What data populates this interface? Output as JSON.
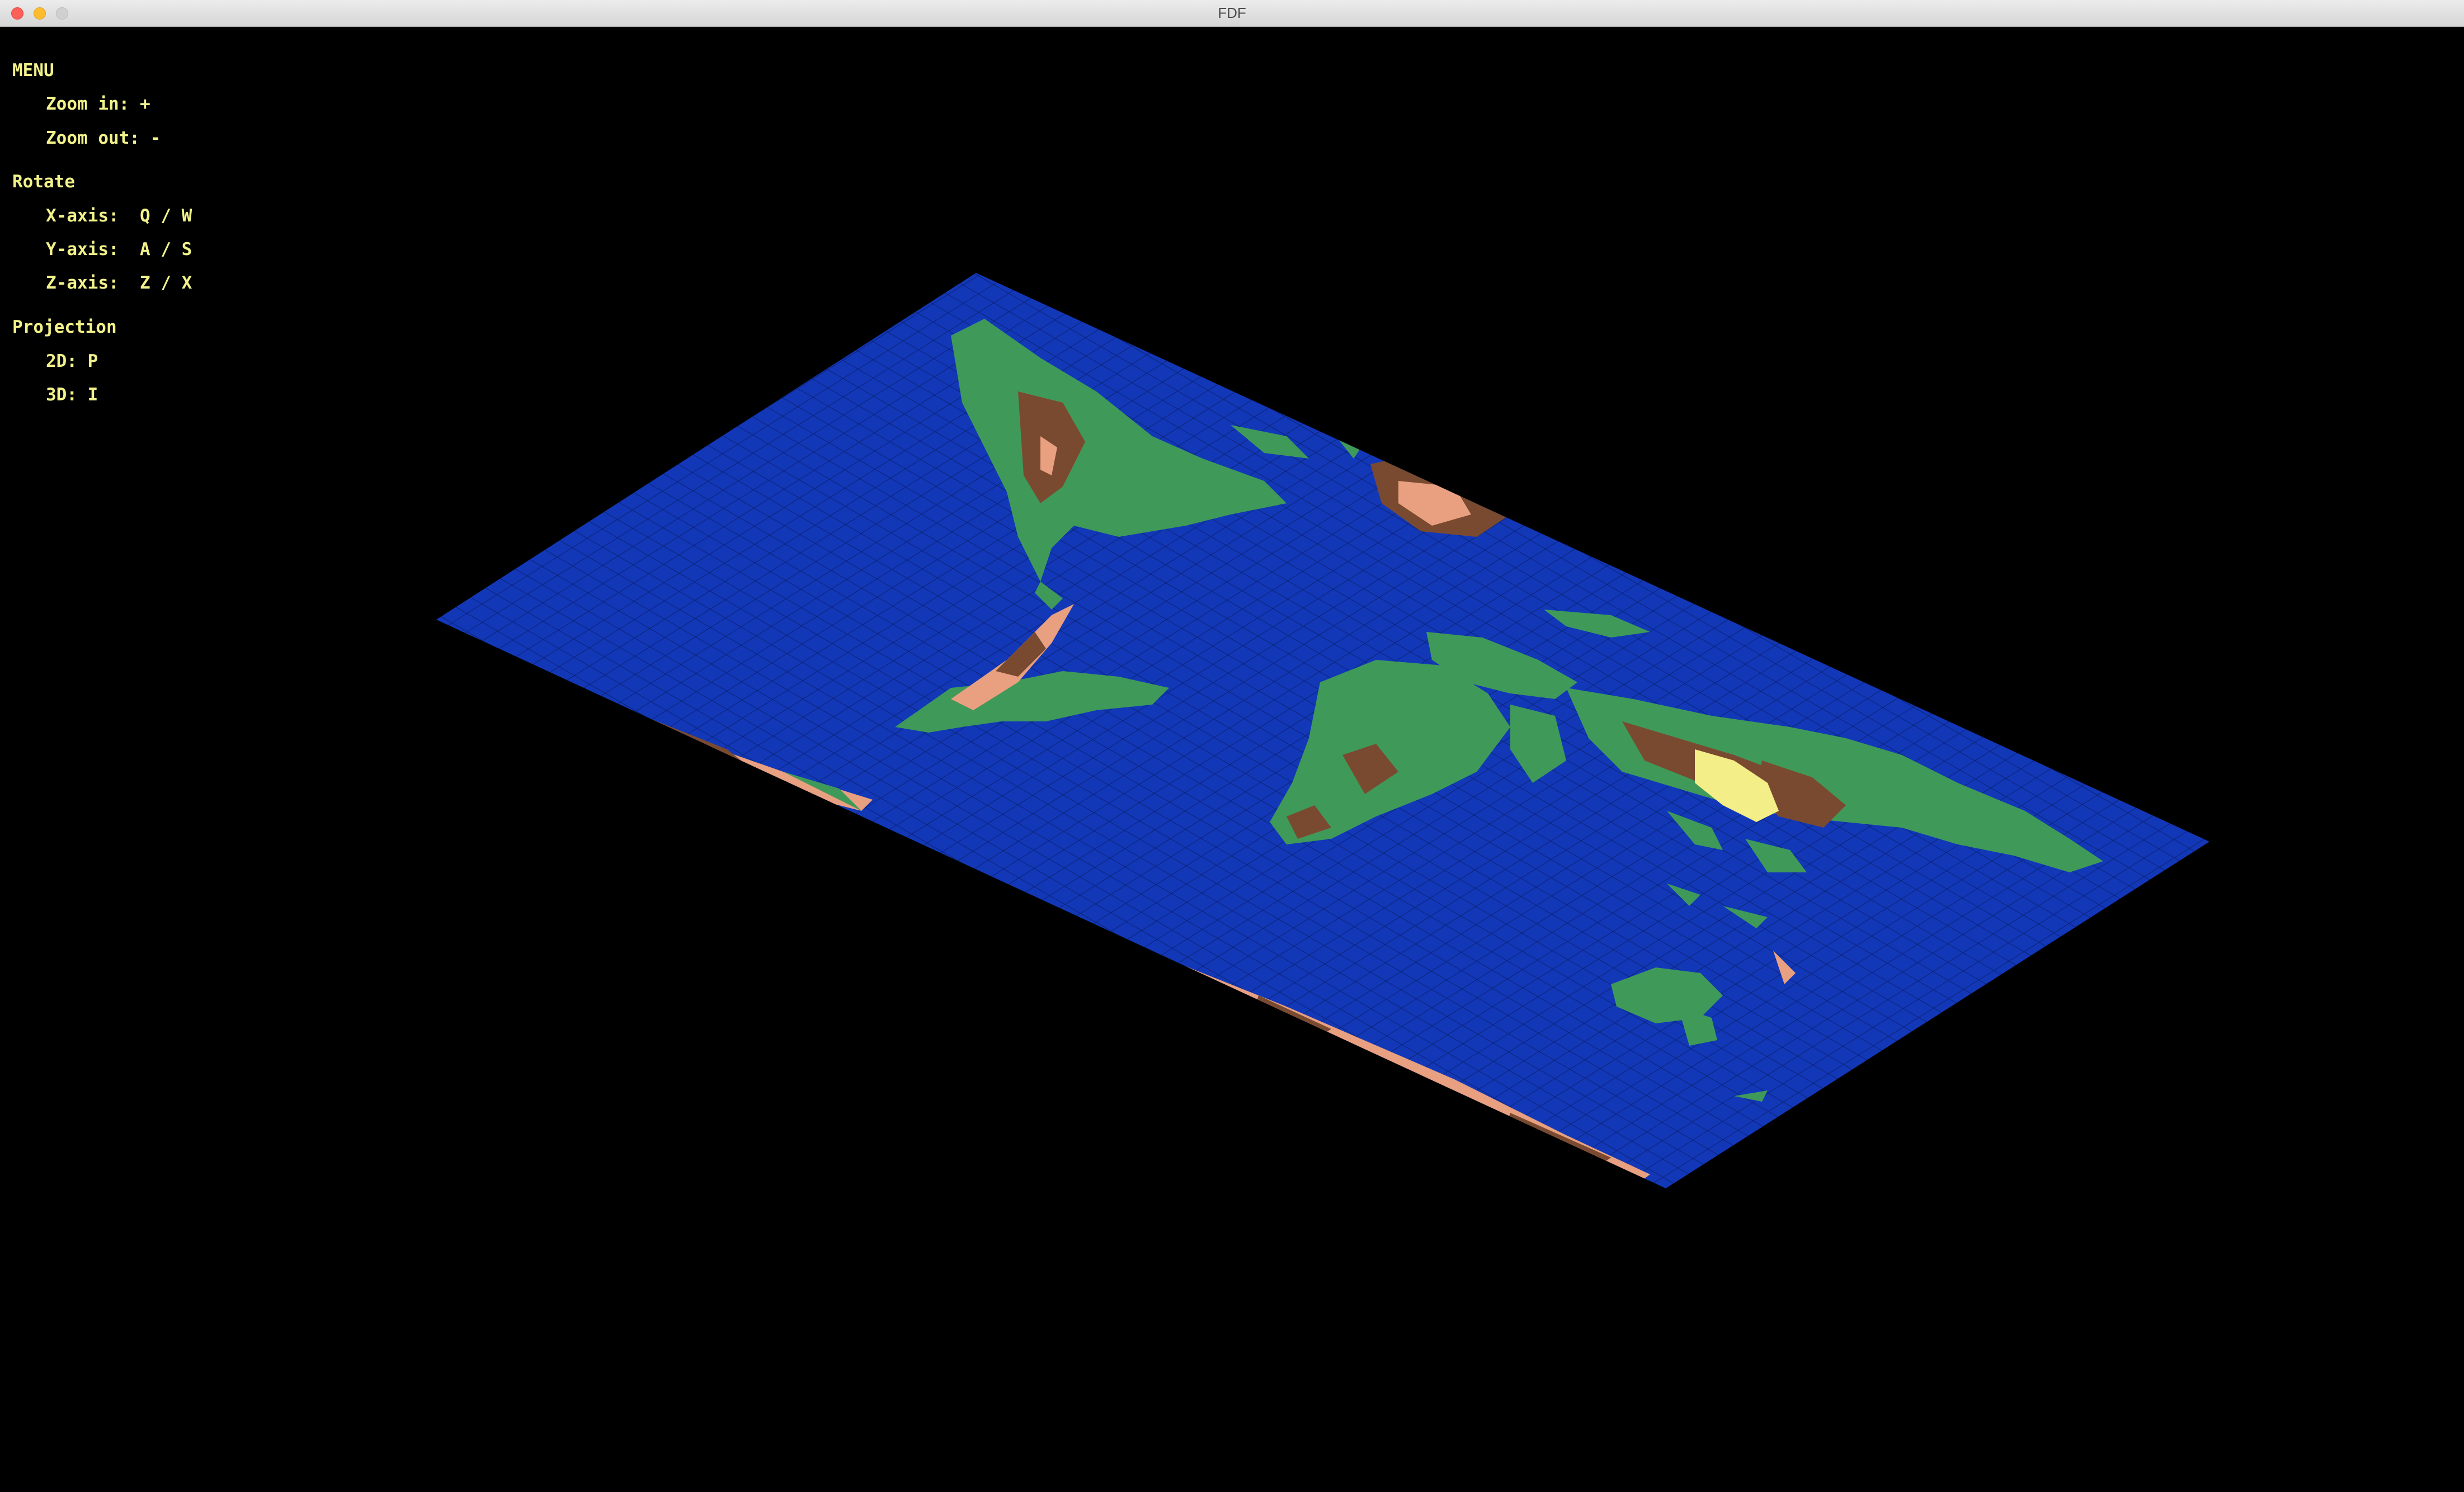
{
  "window": {
    "title": "FDF"
  },
  "menu": {
    "heading": "MENU",
    "zoom_in": "Zoom in: +",
    "zoom_out": "Zoom out: -",
    "rotate_heading": "Rotate",
    "x_axis": "X-axis:  Q / W",
    "y_axis": "Y-axis:  A / S",
    "z_axis": "Z-axis:  Z / X",
    "projection_heading": "Projection",
    "proj_2d": "2D: P",
    "proj_3d": "3D: I"
  },
  "colors": {
    "menu_text": "#f2f28a",
    "ocean": "#1238b8",
    "grid_line": "#0a1f6e",
    "land_low": "#3f9a5a",
    "land_mid": "#7a4a30",
    "land_high": "#e8a080",
    "peak": "#f4ee88"
  }
}
